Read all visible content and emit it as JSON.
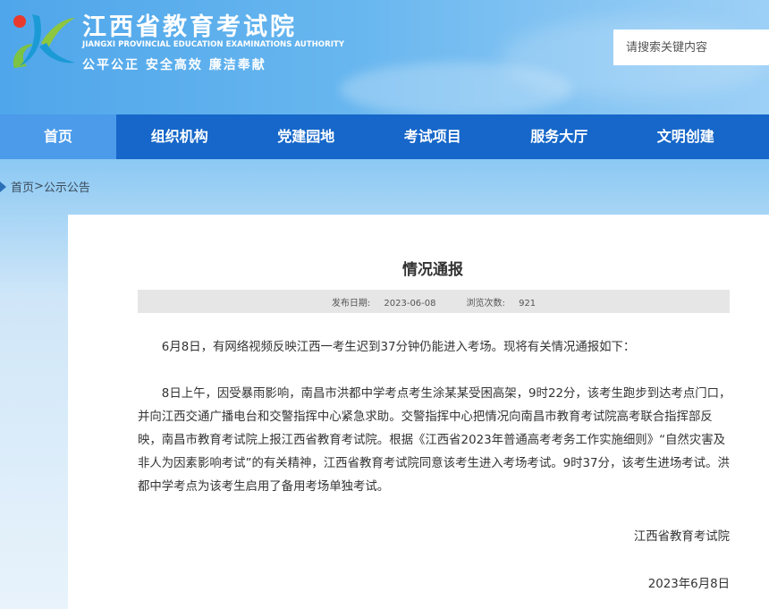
{
  "header": {
    "title_cn": "江西省教育考试院",
    "title_en": "JIANGXI PROVINCIAL EDUCATION EXAMINATIONS AUTHORITY",
    "slogan": "公平公正  安全高效  廉洁奉献",
    "logo_icon": "jx-logo-icon",
    "search_placeholder": "请搜索关键内容"
  },
  "nav": {
    "items": [
      {
        "label": "首页",
        "active": true
      },
      {
        "label": "组织机构",
        "active": false
      },
      {
        "label": "党建园地",
        "active": false
      },
      {
        "label": "考试项目",
        "active": false
      },
      {
        "label": "服务大厅",
        "active": false
      },
      {
        "label": "文明创建",
        "active": false
      }
    ]
  },
  "breadcrumb": {
    "icon": "home-marker-icon",
    "home": "首页",
    "separator": ">",
    "current": "公示公告"
  },
  "article": {
    "title": "情况通报",
    "publish_label": "发布日期:",
    "publish_date": "2023-06-08",
    "views_label": "浏览次数:",
    "views": "921",
    "paragraph1": "6月8日，有网络视频反映江西一考生迟到37分钟仍能进入考场。现将有关情况通报如下：",
    "paragraph2": "8日上午，因受暴雨影响，南昌市洪都中学考点考生涂某某受困高架，9时22分，该考生跑步到达考点门口，并向江西交通广播电台和交警指挥中心紧急求助。交警指挥中心把情况向南昌市教育考试院高考联合指挥部反映，南昌市教育考试院上报江西省教育考试院。根据《江西省2023年普通高考考务工作实施细则》“自然灾害及非人为因素影响考试”的有关精神，江西省教育考试院同意该考生进入考场考试。9时37分，该考生进场考试。洪都中学考点为该考生启用了备用考场单独考试。",
    "signature": "江西省教育考试院",
    "date": "2023年6月8日"
  },
  "colors": {
    "nav_bg": "#1667c9",
    "nav_active": "#4b9bea",
    "meta_bg": "#e6e6e6"
  }
}
